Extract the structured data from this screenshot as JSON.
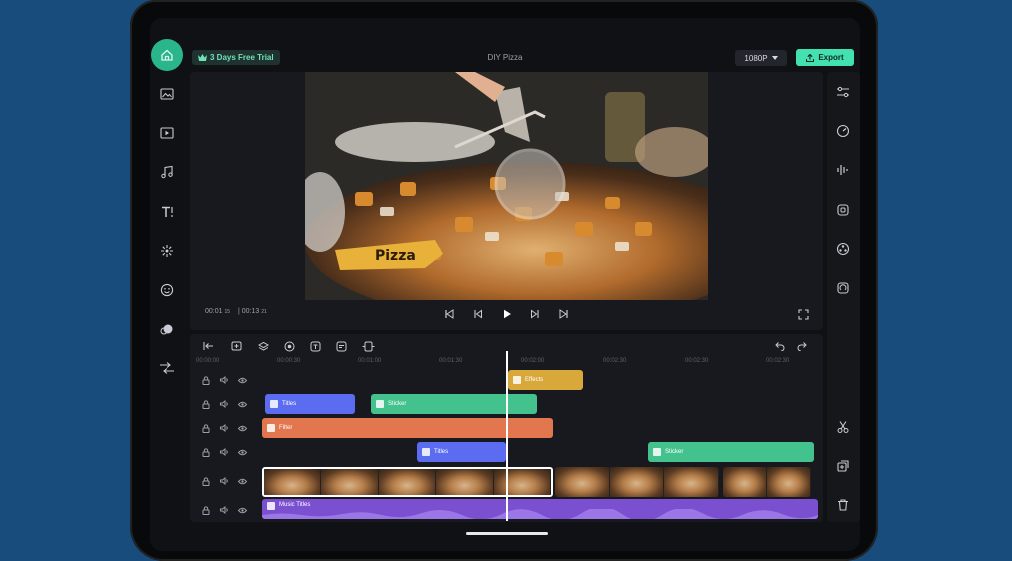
{
  "topbar": {
    "trial_label": "3 Days Free Trial",
    "project_title": "DIY Pizza",
    "resolution": "1080P",
    "export_label": "Export"
  },
  "preview": {
    "caption": "Pizza",
    "current_time": "00:01",
    "current_frames": "15",
    "total_time": "| 00:13",
    "total_frames": "21"
  },
  "left_tools": [
    "image-icon",
    "video-icon",
    "music-icon",
    "text-icon",
    "effects-icon",
    "sticker-icon",
    "filter-icon",
    "transition-icon"
  ],
  "right_tools": [
    "adjust-icon",
    "speed-icon",
    "audio-icon",
    "crop-icon",
    "mask-icon",
    "rotate-icon",
    "split-icon",
    "duplicate-icon",
    "delete-icon"
  ],
  "timeline": {
    "ticks": [
      "00:00:00",
      "00:00:30",
      "00:01:00",
      "00:01:30",
      "00:02:00",
      "00:02:30",
      "00:02:30",
      "00:02:30"
    ],
    "clips": {
      "effects": "Effects",
      "titles1": "Titles",
      "sticker1": "Sticker",
      "filter": "Filter",
      "titles2": "Titles",
      "sticker2": "Sticker",
      "music": "Music Titles"
    }
  },
  "colors": {
    "accent": "#43e0b0",
    "effects": "#d9a83a",
    "titles": "#5b6cf0",
    "sticker": "#43c28e",
    "filter": "#e2774f",
    "music": "#7a4fd0"
  }
}
